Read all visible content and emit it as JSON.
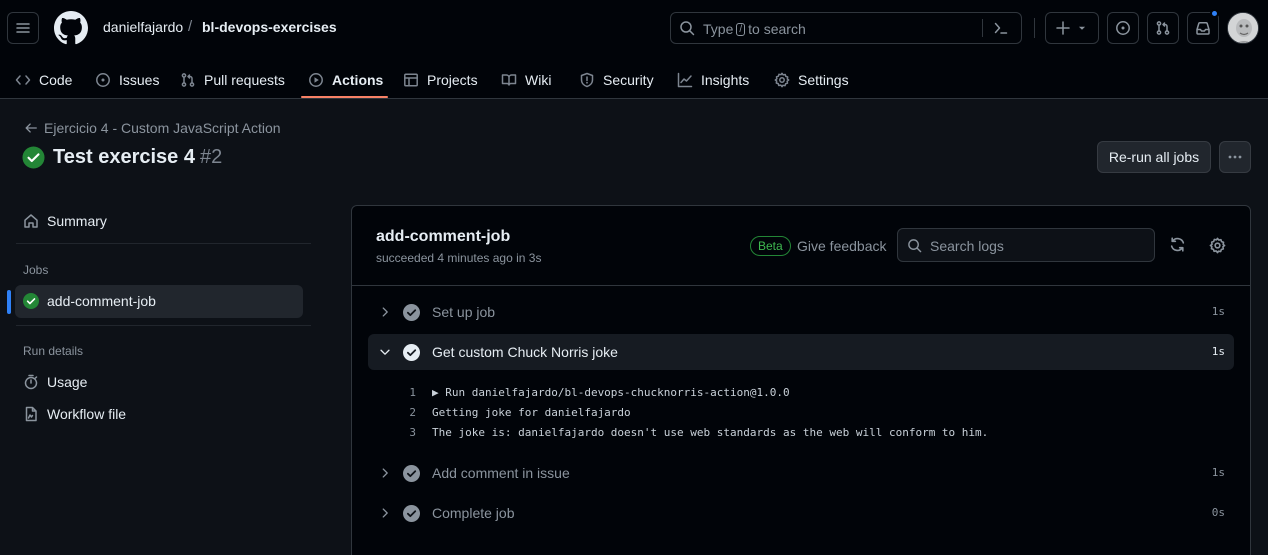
{
  "header": {
    "owner": "danielfajardo",
    "separator": "/",
    "repo": "bl-devops-exercises",
    "search": {
      "before": "Type",
      "key": "/",
      "after": "to search"
    },
    "tabs": [
      {
        "label": "Code",
        "icon": "code-icon"
      },
      {
        "label": "Issues",
        "icon": "issue-icon"
      },
      {
        "label": "Pull requests",
        "icon": "pull-request-icon"
      },
      {
        "label": "Actions",
        "icon": "play-icon",
        "active": true
      },
      {
        "label": "Projects",
        "icon": "table-icon"
      },
      {
        "label": "Wiki",
        "icon": "book-icon"
      },
      {
        "label": "Security",
        "icon": "shield-icon"
      },
      {
        "label": "Insights",
        "icon": "graph-icon"
      },
      {
        "label": "Settings",
        "icon": "gear-icon"
      }
    ]
  },
  "run": {
    "workflow": "Ejercicio 4 - Custom JavaScript Action",
    "title": "Test exercise 4",
    "number": "#2",
    "rerun_label": "Re-run all jobs"
  },
  "sidebar": {
    "summary": "Summary",
    "jobs_label": "Jobs",
    "job": "add-comment-job",
    "run_details_label": "Run details",
    "usage": "Usage",
    "workflow_file": "Workflow file"
  },
  "job": {
    "name": "add-comment-job",
    "status": "succeeded 4 minutes ago in 3s",
    "beta": "Beta",
    "feedback": "Give feedback",
    "search_placeholder": "Search logs",
    "steps": [
      {
        "name": "Set up job",
        "duration": "1s"
      },
      {
        "name": "Get custom Chuck Norris joke",
        "duration": "1s",
        "expanded": true
      },
      {
        "name": "Add comment in issue",
        "duration": "1s"
      },
      {
        "name": "Complete job",
        "duration": "0s"
      }
    ],
    "log": [
      {
        "n": "1",
        "text": "▶ Run danielfajardo/bl-devops-chucknorris-action@1.0.0"
      },
      {
        "n": "2",
        "text": "Getting joke for danielfajardo"
      },
      {
        "n": "3",
        "text": "The joke is: danielfajardo doesn't use web standards as the web will conform to him."
      }
    ]
  },
  "colors": {
    "success": "#238636",
    "accent": "#2f81f7",
    "tab_underline": "#f78166",
    "background": "#0d1117"
  }
}
